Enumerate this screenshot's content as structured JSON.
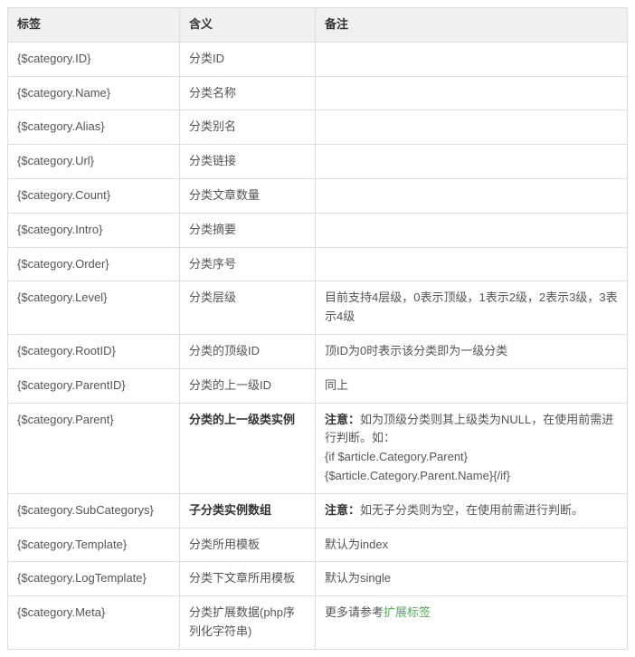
{
  "headers": {
    "tag": "标签",
    "meaning": "含义",
    "note": "备注"
  },
  "rows": [
    {
      "tag": "{$category.ID}",
      "meaning": "分类ID",
      "note": ""
    },
    {
      "tag": "{$category.Name}",
      "meaning": "分类名称",
      "note": ""
    },
    {
      "tag": "{$category.Alias}",
      "meaning": "分类别名",
      "note": ""
    },
    {
      "tag": "{$category.Url}",
      "meaning": "分类链接",
      "note": ""
    },
    {
      "tag": "{$category.Count}",
      "meaning": "分类文章数量",
      "note": ""
    },
    {
      "tag": "{$category.Intro}",
      "meaning": "分类摘要",
      "note": ""
    },
    {
      "tag": "{$category.Order}",
      "meaning": "分类序号",
      "note": ""
    },
    {
      "tag": "{$category.Level}",
      "meaning": "分类层级",
      "note": "目前支持4层级，0表示顶级，1表示2级，2表示3级，3表示4级"
    },
    {
      "tag": "{$category.RootID}",
      "meaning": "分类的顶级ID",
      "note": "顶ID为0时表示该分类即为一级分类"
    },
    {
      "tag": "{$category.ParentID}",
      "meaning": "分类的上一级ID",
      "note": "同上"
    },
    {
      "tag": "{$category.Parent}",
      "meaning": "分类的上一级类实例",
      "meaningBold": true,
      "noteLabel": "注意：",
      "noteText": "如为顶级分类则其上级类为NULL，在使用前需进行判断。如：",
      "noteCode1": "{if $article.Category.Parent}",
      "noteCode2": "{$article.Category.Parent.Name}{/if}"
    },
    {
      "tag": "{$category.SubCategorys}",
      "meaning": "子分类实例数组",
      "meaningBold": true,
      "noteLabel": "注意：",
      "noteText": "如无子分类则为空，在使用前需进行判断。"
    },
    {
      "tag": "{$category.Template}",
      "meaning": "分类所用模板",
      "note": "默认为index"
    },
    {
      "tag": "{$category.LogTemplate}",
      "meaning": "分类下文章所用模板",
      "note": "默认为single"
    },
    {
      "tag": "{$category.Meta}",
      "meaning": "分类扩展数据(php序列化字符串)",
      "notePrefix": "更多请参考",
      "noteLink": "扩展标签"
    }
  ]
}
